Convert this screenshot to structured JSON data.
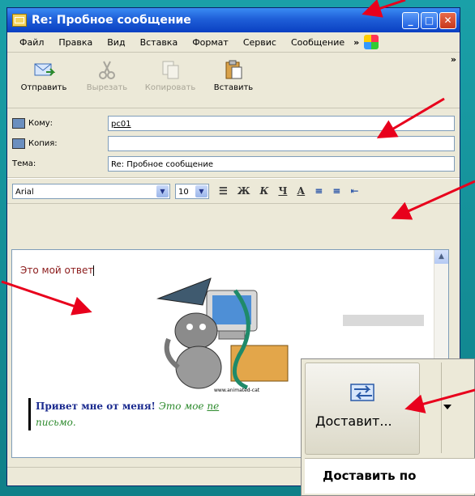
{
  "window": {
    "title": "Re: Пробное сообщение"
  },
  "menu": {
    "items": [
      "Файл",
      "Правка",
      "Вид",
      "Вставка",
      "Формат",
      "Сервис",
      "Сообщение"
    ],
    "more": "»"
  },
  "toolbar": {
    "send": "Отправить",
    "cut": "Вырезать",
    "copy": "Копировать",
    "paste": "Вставить",
    "more": "»"
  },
  "fields": {
    "to_label": "Кому:",
    "to_value": "pc01",
    "cc_label": "Копия:",
    "cc_value": "",
    "subject_label": "Тема:",
    "subject_value": "Re: Пробное сообщение"
  },
  "format": {
    "font": "Arial",
    "size": "10",
    "bold": "Ж",
    "italic": "К",
    "underline": "Ч",
    "color": "А"
  },
  "body": {
    "my_text": "Это мой ответ",
    "cartoon_caption": "www.animated-cat",
    "quote_bold": "Привет мне от меня!",
    "quote_italic": "Это мое",
    "quote_underline": "пе",
    "quote_line2": "письмо."
  },
  "popup": {
    "button_label": "Доставит...",
    "tooltip": "Доставить по"
  },
  "colors": {
    "titlebar": "#1f5fd8",
    "arrows": "#e8001c",
    "quote_bold": "#1b2b8f",
    "quote_italic": "#2e8b2e"
  }
}
